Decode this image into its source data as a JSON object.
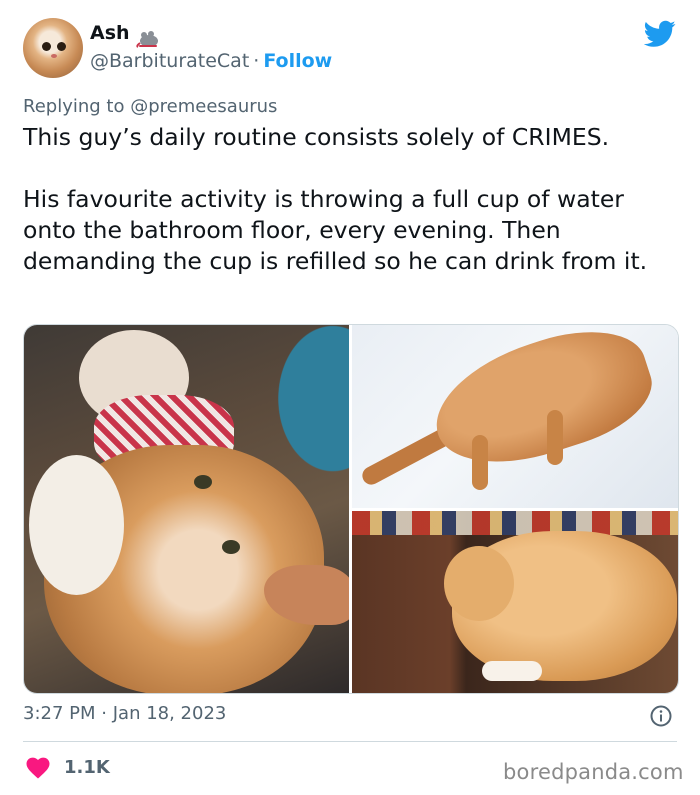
{
  "author": {
    "name": "Ash",
    "handle": "@BarbiturateCat",
    "separator": "·",
    "follow_label": "Follow",
    "avatar_icon": "cat-avatar",
    "badge_icon": "mouse-icon"
  },
  "reply": {
    "prefix": "Replying to",
    "mention": "@premeesaurus"
  },
  "text": {
    "paragraph1": "This guy’s daily routine consists solely of CRIMES.",
    "paragraph2": "His favourite activity is throwing a full cup of water onto the bathroom floor, every evening. Then demanding the cup is refilled so he can drink from it."
  },
  "media": {
    "photos": [
      "orange-cat-held-closeup-photo",
      "orange-cat-in-snow-photo",
      "orange-cat-on-shelf-photo"
    ]
  },
  "footer": {
    "time": "3:27 PM",
    "separator": "·",
    "date": "Jan 18, 2023",
    "likes": "1.1K",
    "watermark": "boredpanda.com"
  },
  "colors": {
    "accent": "#1d9bf0",
    "heart": "#f91880",
    "muted": "#536471",
    "text": "#0f1419"
  }
}
